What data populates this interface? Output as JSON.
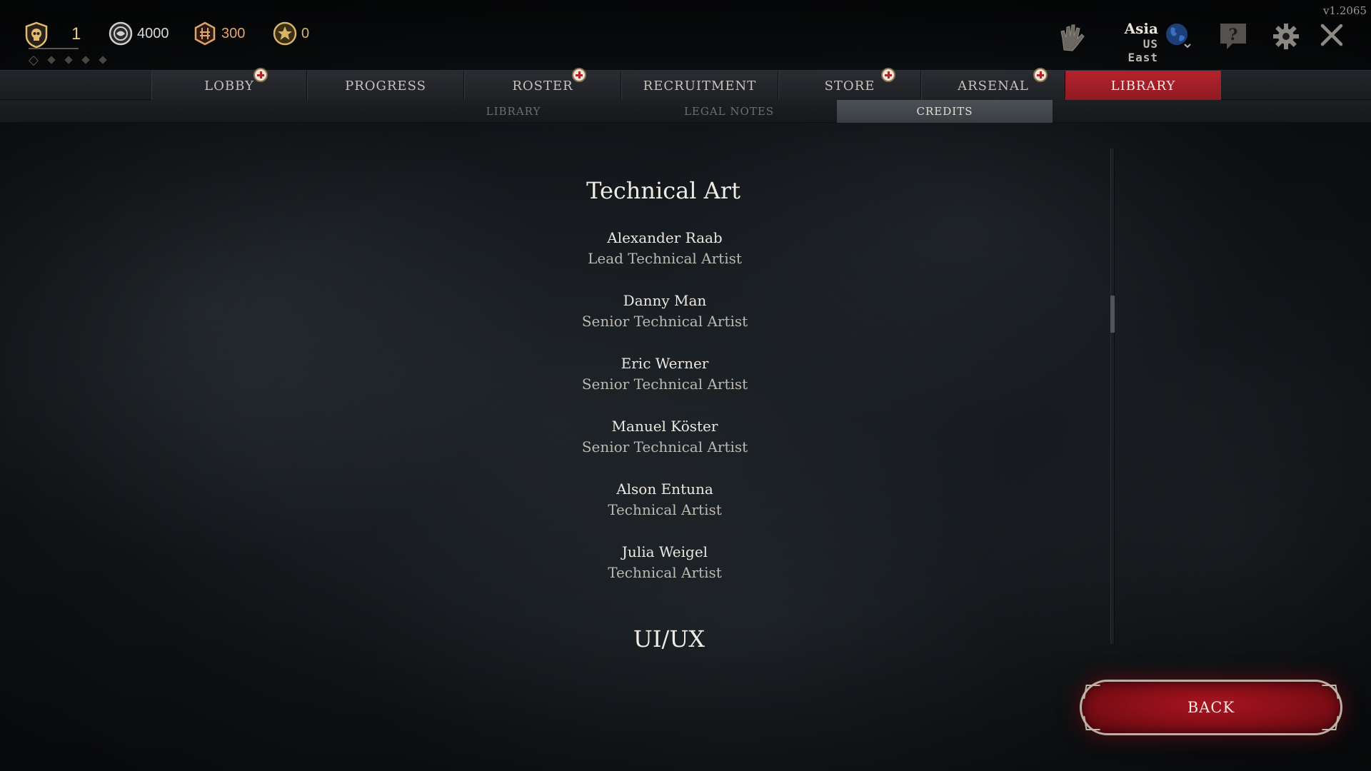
{
  "hud": {
    "rank": "1",
    "currencies": [
      {
        "icon": "iron-coin-icon",
        "value": "4000"
      },
      {
        "icon": "bronze-shard-icon",
        "value": "300"
      },
      {
        "icon": "gold-medal-icon",
        "value": "0"
      }
    ],
    "version": "v1.2065",
    "region": {
      "name": "Asia",
      "server": "US East"
    },
    "colors": {
      "accent_red": "#b3232c",
      "gold": "#e9c98a",
      "copper": "#e2a46a"
    }
  },
  "main_nav": {
    "tabs": [
      {
        "label": "LOBBY",
        "badge": true
      },
      {
        "label": "PROGRESS",
        "badge": false
      },
      {
        "label": "ROSTER",
        "badge": true
      },
      {
        "label": "RECRUITMENT",
        "badge": false
      },
      {
        "label": "STORE",
        "badge": true
      },
      {
        "label": "ARSENAL",
        "badge": true
      },
      {
        "label": "LIBRARY",
        "badge": false,
        "active": true
      }
    ]
  },
  "sub_nav": {
    "tabs": [
      {
        "label": "LIBRARY"
      },
      {
        "label": "LEGAL NOTES"
      },
      {
        "label": "CREDITS",
        "active": true
      }
    ]
  },
  "credits": {
    "sections": [
      {
        "title": "Technical Art",
        "entries": [
          {
            "name": "Alexander Raab",
            "role": "Lead Technical Artist"
          },
          {
            "name": "Danny Man",
            "role": "Senior Technical Artist"
          },
          {
            "name": "Eric Werner",
            "role": "Senior Technical Artist"
          },
          {
            "name": "Manuel Köster",
            "role": "Senior Technical Artist"
          },
          {
            "name": "Alson Entuna",
            "role": "Technical Artist"
          },
          {
            "name": "Julia Weigel",
            "role": "Technical Artist"
          }
        ]
      },
      {
        "title": "UI/UX",
        "entries": []
      }
    ]
  },
  "back_button": {
    "label": "BACK"
  }
}
